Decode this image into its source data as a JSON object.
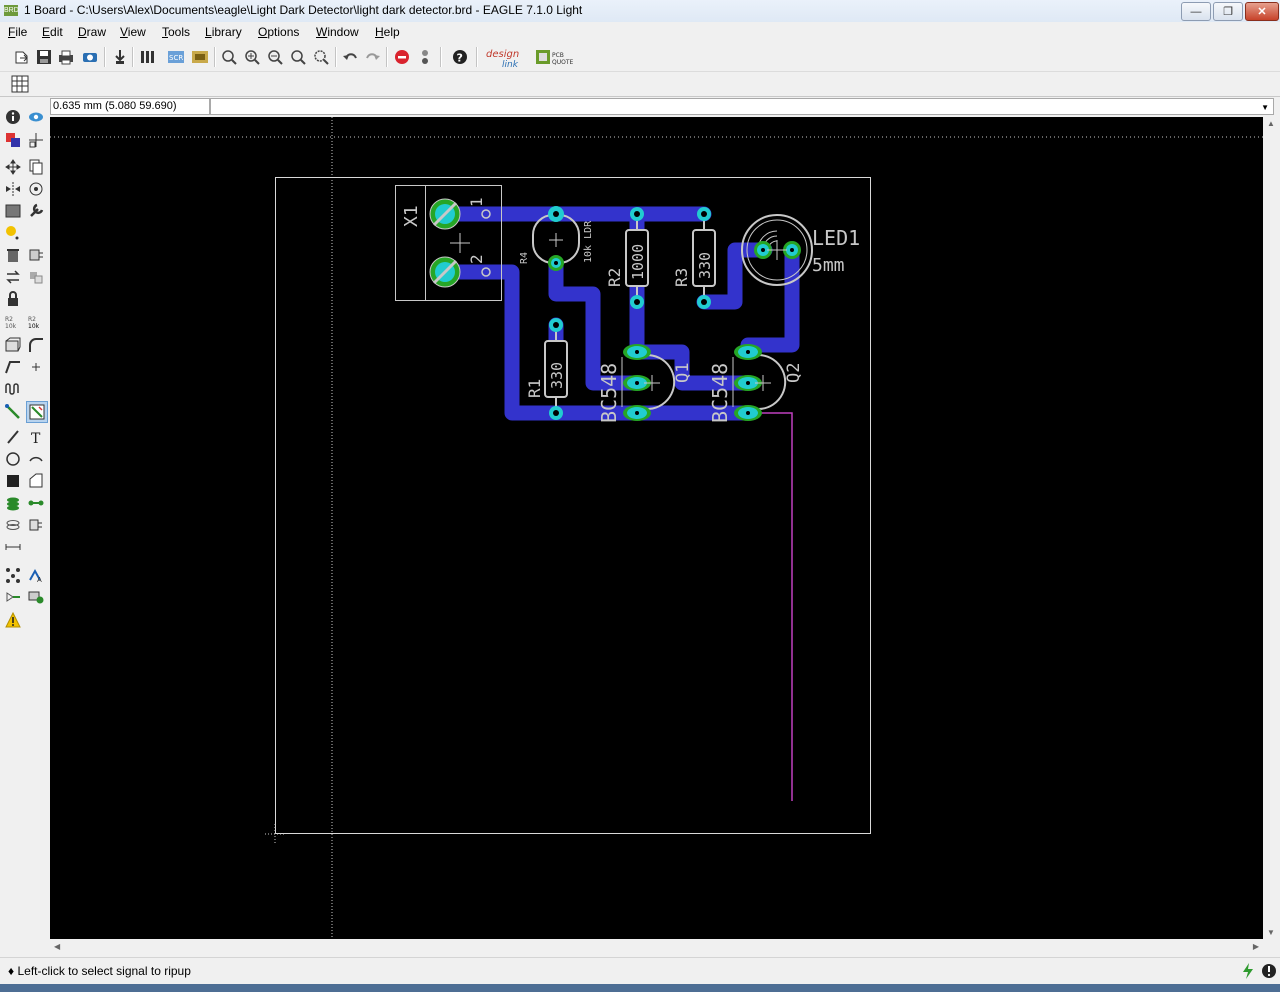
{
  "window": {
    "icon_label": "BRD",
    "title": "1 Board - C:\\Users\\Alex\\Documents\\eagle\\Light Dark Detector\\light dark detector.brd - EAGLE 7.1.0 Light"
  },
  "menu": [
    "File",
    "Edit",
    "Draw",
    "View",
    "Tools",
    "Library",
    "Options",
    "Window",
    "Help"
  ],
  "toolbar": {
    "designlink_label": "design link",
    "pcbquote_label": "PCB QUOTE"
  },
  "coord": {
    "readout": "0.635 mm (5.080 59.690)",
    "command": ""
  },
  "status": {
    "message": "Left-click to select signal to ripup"
  },
  "board": {
    "labels": {
      "x1": "X1",
      "pin1": "1",
      "pin2": "2",
      "r4": "R4",
      "ldr": "10k LDR",
      "r2": "R2",
      "r2_value": "1000",
      "r3": "R3",
      "r3_value": "330",
      "r1": "R1",
      "r1_value": "330",
      "led": "LED1",
      "led_value": "5mm",
      "q1": "Q1",
      "q1_value": "BC548",
      "q2": "Q2",
      "q2_value": "BC548"
    }
  },
  "colors": {
    "trace": "#3333cc",
    "via": "#21ccd0",
    "pad_green": "#26a626",
    "airwire": "#c040c0"
  }
}
